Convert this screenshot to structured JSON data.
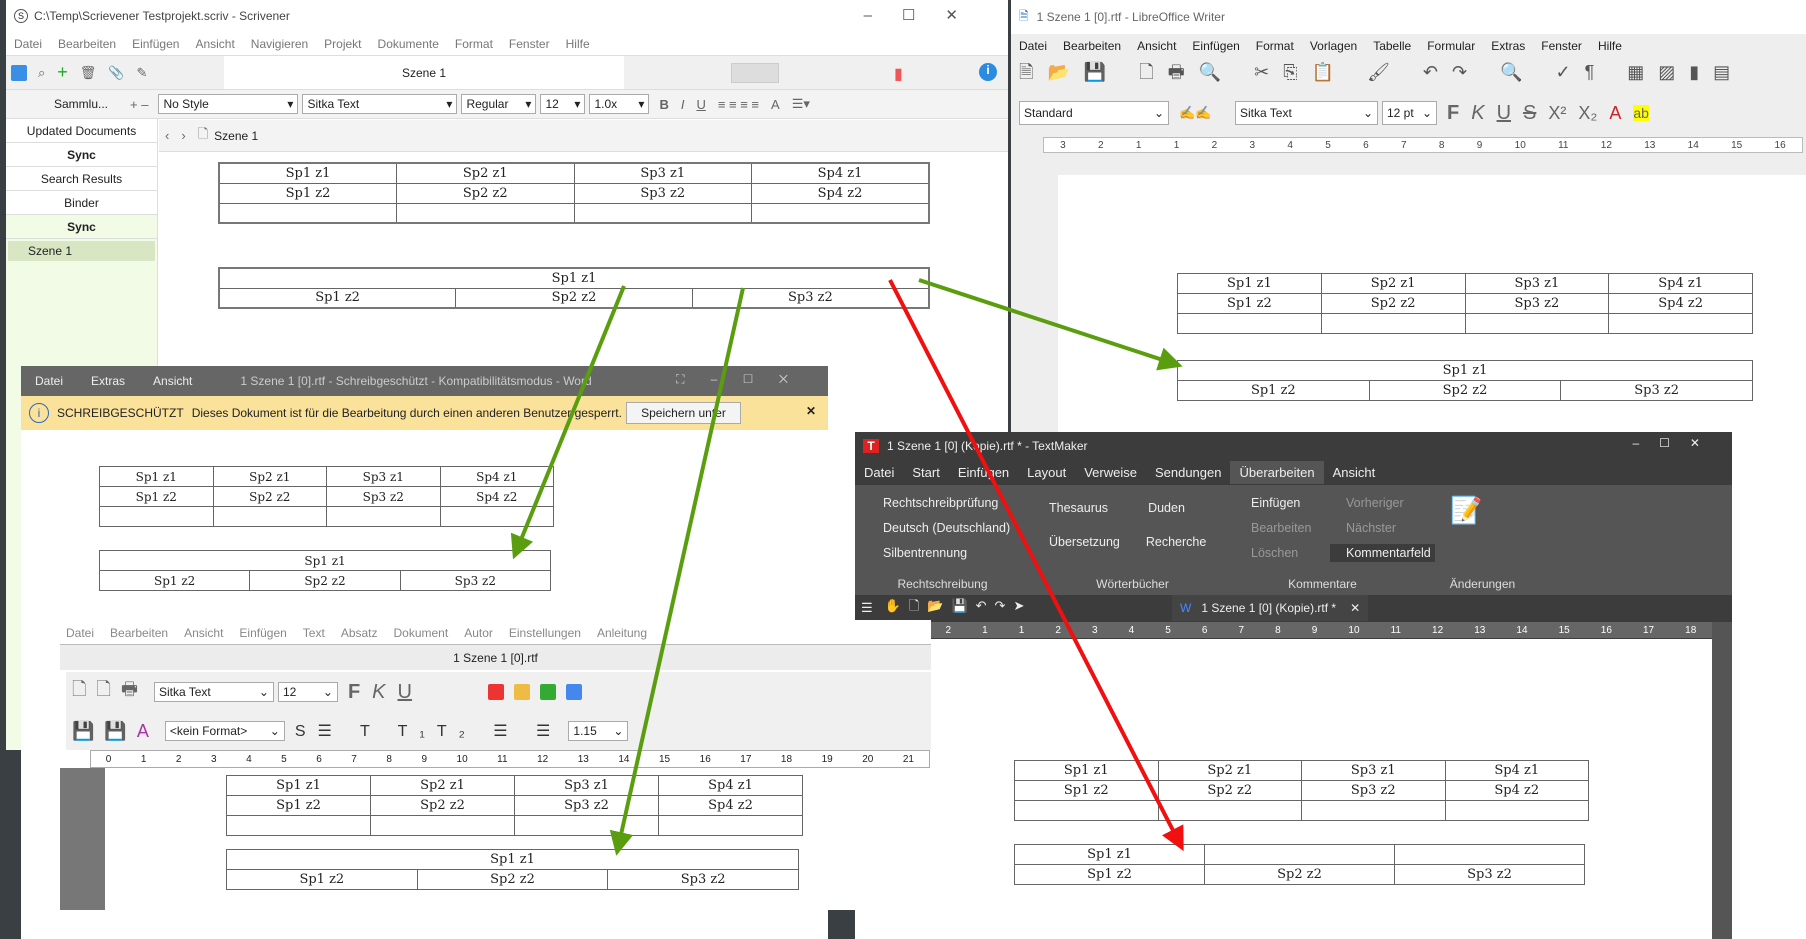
{
  "colors": {
    "green_arrow": "#5a9e10",
    "red_arrow": "#f01010",
    "word_bar": "#fbe29a",
    "textmaker_dark": "#3c3c3c",
    "textmaker_ribbon": "#555555",
    "textmaker_active_tab": "#6a6a6a"
  },
  "scrivener": {
    "title": "C:\\Temp\\Scrievener Testprojekt.scriv - Scrivener",
    "menu": [
      "Datei",
      "Bearbeiten",
      "Einfügen",
      "Ansicht",
      "Navigieren",
      "Projekt",
      "Dokumente",
      "Format",
      "Fenster",
      "Hilfe"
    ],
    "doc_title": "Szene 1",
    "collection": "Sammlu...",
    "style": "No Style",
    "font": "Sitka Text",
    "weight": "Regular",
    "size": "12",
    "spacing": "1.0x",
    "binder_tabs": [
      "Updated Documents",
      "Sync",
      "Search Results",
      "Binder"
    ],
    "sync_header": "Sync",
    "binder_item": "Szene 1",
    "breadcrumb": "Szene 1"
  },
  "writer": {
    "title": "1 Szene 1 [0].rtf - LibreOffice Writer",
    "menu": [
      "Datei",
      "Bearbeiten",
      "Ansicht",
      "Einfügen",
      "Format",
      "Vorlagen",
      "Tabelle",
      "Formular",
      "Extras",
      "Fenster",
      "Hilfe"
    ],
    "style": "Standard",
    "font": "Sitka Text",
    "size": "12 pt",
    "ruler": [
      "3",
      "2",
      "1",
      "1",
      "2",
      "3",
      "4",
      "5",
      "6",
      "7",
      "8",
      "9",
      "10",
      "11",
      "12",
      "13",
      "14",
      "15",
      "16"
    ]
  },
  "word": {
    "menu": [
      "Datei",
      "Extras",
      "Ansicht"
    ],
    "title": "1 Szene 1 [0].rtf  -  Schreibgeschützt  -  Kompatibilitätsmodus  -  Word",
    "banner_label": "SCHREIBGESCHÜTZT",
    "banner_text": "Dieses Dokument ist für die Bearbeitung durch einen anderen Benutzer gesperrt.",
    "banner_button": "Speichern unter"
  },
  "papyrus": {
    "menu": [
      "Datei",
      "Bearbeiten",
      "Ansicht",
      "Einfügen",
      "Text",
      "Absatz",
      "Dokument",
      "Autor",
      "Einstellungen",
      "Anleitung"
    ],
    "title": "1 Szene 1 [0].rtf",
    "font": "Sitka Text",
    "size": "12",
    "format": "<kein Format>",
    "spacing": "1.15",
    "ruler": [
      "0",
      "1",
      "2",
      "3",
      "4",
      "5",
      "6",
      "7",
      "8",
      "9",
      "10",
      "11",
      "12",
      "13",
      "14",
      "15",
      "16",
      "17",
      "18",
      "19",
      "20",
      "21"
    ]
  },
  "textmaker": {
    "title": "1 Szene 1 [0] (Kopie).rtf * - TextMaker",
    "tabs": [
      "Datei",
      "Start",
      "Einfügen",
      "Layout",
      "Verweise",
      "Sendungen",
      "Überarbeiten",
      "Ansicht"
    ],
    "active_tab": "Überarbeiten",
    "groups": [
      {
        "label": "Rechtschreibung",
        "items": [
          "Rechtschreibprüfung",
          "Deutsch (Deutschland)",
          "Silbentrennung"
        ]
      },
      {
        "label": "Wörterbücher",
        "items": [
          "Thesaurus",
          "Duden",
          "Übersetzung",
          "Recherche"
        ]
      },
      {
        "label": "Kommentare",
        "items": [
          "Einfügen",
          "Vorheriger",
          "Bearbeiten",
          "Nächster",
          "Löschen",
          "Kommentarfeld"
        ]
      },
      {
        "label": "Änderungen",
        "items": []
      }
    ],
    "doc_tab": "1 Szene 1 [0] (Kopie).rtf *",
    "ruler": [
      "2",
      "1",
      "1",
      "2",
      "3",
      "4",
      "5",
      "6",
      "7",
      "8",
      "9",
      "10",
      "11",
      "12",
      "13",
      "14",
      "15",
      "16",
      "17",
      "18"
    ]
  },
  "tables": {
    "table1": [
      [
        "Sp1 z1",
        "Sp2 z1",
        "Sp3 z1",
        "Sp4 z1"
      ],
      [
        "Sp1 z2",
        "Sp2 z2",
        "Sp3 z2",
        "Sp4 z2"
      ],
      [
        "",
        "",
        "",
        ""
      ]
    ],
    "table2_header": "Sp1 z1",
    "table2_row": [
      "Sp1 z2",
      "Sp2 z2",
      "Sp3 z2"
    ]
  }
}
